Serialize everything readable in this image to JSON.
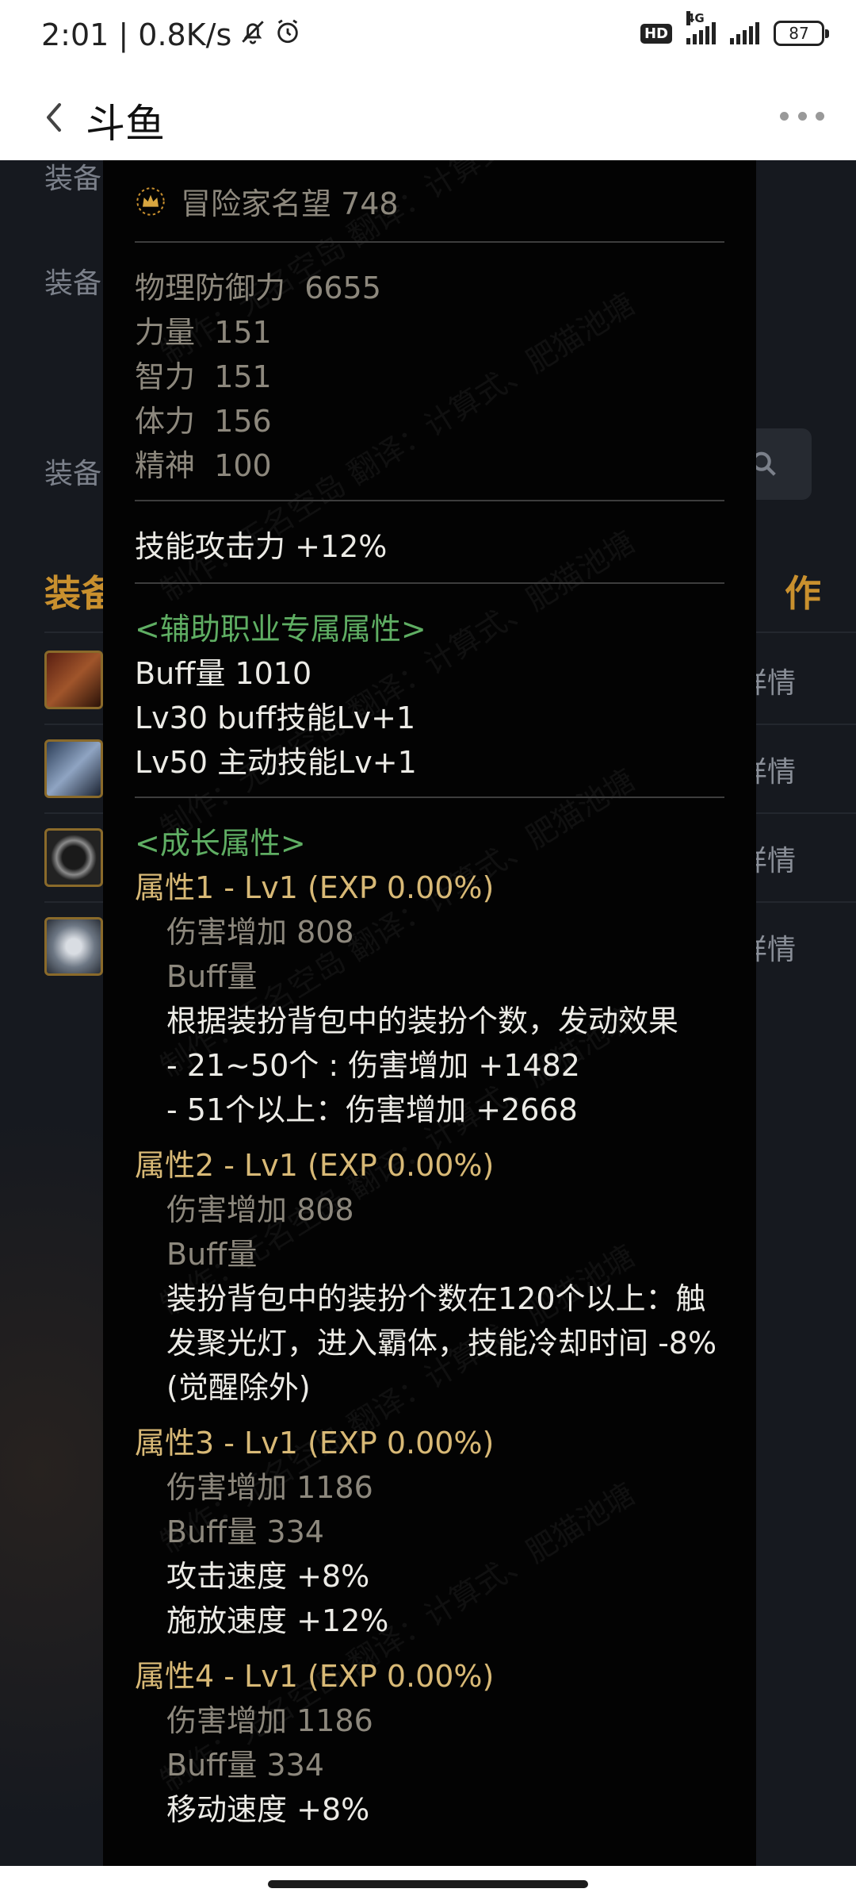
{
  "status_bar": {
    "time_speed": "2:01 | 0.8K/s",
    "network_label": "4G",
    "hd_label": "HD",
    "battery": "87"
  },
  "header": {
    "title": "斗鱼"
  },
  "background_page": {
    "label_1": "装备",
    "label_2": "装备",
    "label_3": "装备",
    "heading_left": "装备",
    "heading_right": "作",
    "detail_label": "详情"
  },
  "tooltip": {
    "reputation": "冒险家名望 748",
    "stats": [
      {
        "name": "物理防御力",
        "value": "6655"
      },
      {
        "name": "力量",
        "value": "151"
      },
      {
        "name": "智力",
        "value": "151"
      },
      {
        "name": "体力",
        "value": "156"
      },
      {
        "name": "精神",
        "value": "100"
      }
    ],
    "skill_attack": "技能攻击力  +12%",
    "support_title": "<辅助职业专属属性>",
    "support_lines": [
      "Buff量   1010",
      "Lv30 buff技能Lv+1",
      "Lv50 主动技能Lv+1"
    ],
    "growth_title": "<成长属性>",
    "attr1": {
      "title": "属性1 - Lv1 (EXP 0.00%)",
      "damage": "伤害增加  808",
      "buff": "Buff量",
      "desc": [
        "根据装扮背包中的装扮个数，发动效果",
        "- 21~50个 : 伤害增加 +1482",
        "- 51个以上：伤害增加 +2668"
      ]
    },
    "attr2": {
      "title": "属性2 - Lv1 (EXP 0.00%)",
      "damage": "伤害增加  808",
      "buff": "Buff量",
      "desc": [
        "装扮背包中的装扮个数在120个以上：触",
        "发聚光灯，进入霸体，技能冷却时间 -8%",
        "(觉醒除外)"
      ]
    },
    "attr3": {
      "title": "属性3 - Lv1 (EXP 0.00%)",
      "damage": "伤害增加  1186",
      "buff": "Buff量  334",
      "desc": [
        "攻击速度 +8%",
        "施放速度 +12%"
      ]
    },
    "attr4": {
      "title": "属性4 - Lv1 (EXP 0.00%)",
      "damage": "伤害增加  1186",
      "buff": "Buff量  334",
      "desc": [
        "移动速度 +8%"
      ]
    },
    "watermark": "制作：无名空岛 翻译：计算式、肥猫池塘"
  },
  "icons": {
    "back": "chevron-left-icon",
    "more": "more-horizontal-icon",
    "mute": "bell-off-icon",
    "alarm": "alarm-icon",
    "reputation": "crown-icon",
    "search": "search-icon"
  }
}
